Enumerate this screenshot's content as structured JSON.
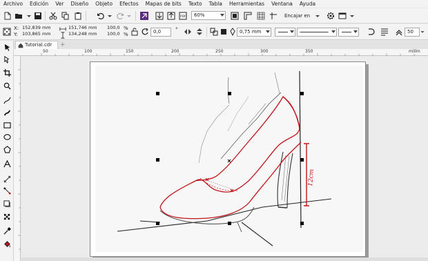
{
  "menu": [
    "Archivo",
    "Edición",
    "Ver",
    "Diseño",
    "Objeto",
    "Efectos",
    "Mapas de bits",
    "Texto",
    "Tabla",
    "Herramientas",
    "Ventana",
    "Ayuda"
  ],
  "toolbar": {
    "zoom_value": "60%",
    "snap_label": "Encajar en",
    "pdf_label": "PDF"
  },
  "property_bar": {
    "x_label": "X:",
    "x_value": "152,839 mm",
    "y_label": "Y:",
    "y_value": "103,865 mm",
    "width_value": "151,746 mm",
    "height_value": "134,248 mm",
    "scale_x": "100,0",
    "scale_y": "100,0",
    "percent_symbol": "%",
    "rotation_value": "0,0",
    "degree_symbol": "°",
    "outline_width": "0,75 mm",
    "smooth_value": "50"
  },
  "document": {
    "tab_title": "Tutorial.cdr",
    "tab_add": "+"
  },
  "ruler": {
    "marks": [
      "50",
      "100",
      "150",
      "200",
      "250",
      "300",
      "350",
      "milím"
    ],
    "unit": "milím"
  },
  "artwork": {
    "annotation": "12cm",
    "outline_color": "#c0161b",
    "annotation_color": "#c0161b"
  }
}
